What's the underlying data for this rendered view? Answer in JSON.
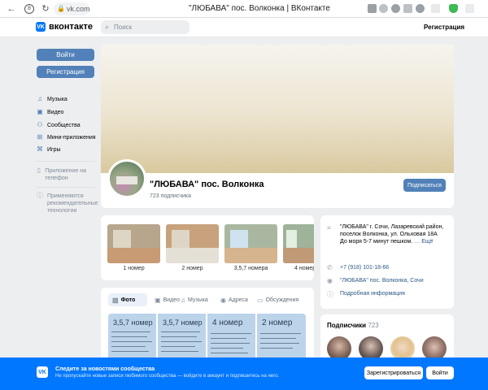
{
  "browser": {
    "url": "vk.com",
    "tab_title": "\"ЛЮБАВА\" пос. Волконка | ВКонтакте"
  },
  "header": {
    "logo_text": "вконтакте",
    "search_placeholder": "Поиск",
    "register_link": "Регистрация"
  },
  "sidebar": {
    "login_button": "Войти",
    "register_button": "Регистрация",
    "nav": [
      {
        "label": "Музыка",
        "icon": "music-icon"
      },
      {
        "label": "Видео",
        "icon": "video-icon"
      },
      {
        "label": "Сообщества",
        "icon": "communities-icon"
      },
      {
        "label": "Мини-приложения",
        "icon": "apps-icon"
      },
      {
        "label": "Игры",
        "icon": "games-icon"
      }
    ],
    "app_promo": "Приложение на телефон",
    "cookie_note": "Применяются рекомендательные технологии"
  },
  "group": {
    "name": "\"ЛЮБАВА\" пос. Волконка",
    "subscribers_text": "723 подписчика",
    "subscribe_button": "Подписаться"
  },
  "products": [
    {
      "label": "1 номер"
    },
    {
      "label": "2 номер"
    },
    {
      "label": "3,5,7 номера"
    },
    {
      "label": "4 номер"
    }
  ],
  "media_tabs": [
    {
      "label": "Фото",
      "icon": "photo-icon"
    },
    {
      "label": "Видео",
      "icon": "video-icon"
    },
    {
      "label": "Музыка",
      "icon": "music-icon"
    },
    {
      "label": "Адреса",
      "icon": "location-icon"
    },
    {
      "label": "Обсуждения",
      "icon": "discussion-icon"
    }
  ],
  "photos": [
    {
      "title": "3,5,7 номер"
    },
    {
      "title": "3,5,7 номер"
    },
    {
      "title": "4 номер"
    },
    {
      "title": "2 номер"
    }
  ],
  "info": {
    "description": "\"ЛЮБАВА\" г. Сочи, Лазаревский район, поселок Волконка, ул. Ольховая 18А До моря 5-7 минут пешком.",
    "more_link": "… Ещё",
    "phone": "+7 (918) 101-18-66",
    "address": "\"ЛЮБАВА\" пос. Волконка, Сочи",
    "details_link": "Подробная информация"
  },
  "subscribers_block": {
    "title": "Подписчики",
    "count": "723"
  },
  "banner": {
    "title": "Следите за новостями сообщества",
    "text": "Не пропускайте новые записи любимого сообщества — войдите в аккаунт и подпишитесь на него.",
    "register_button": "Зарегистрироваться",
    "login_button": "Войти"
  },
  "colors": {
    "vk_blue": "#0077ff",
    "button_blue": "#5181b8",
    "background": "#edeef0"
  }
}
